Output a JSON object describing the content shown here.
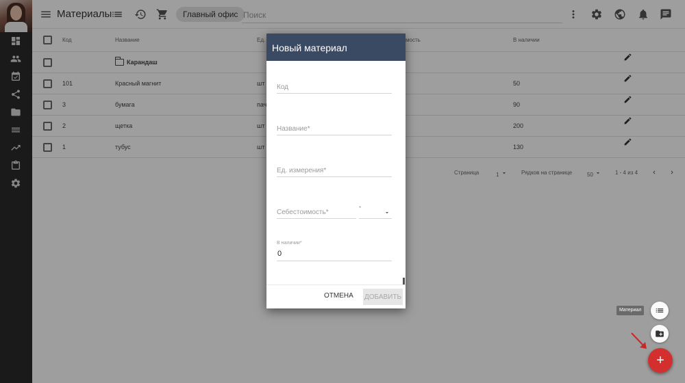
{
  "topbar": {
    "title": "Материалы",
    "office": "Главный офис",
    "search_placeholder": "Поиск"
  },
  "table": {
    "headers": {
      "code": "Код",
      "name": "Название",
      "unit": "Ед.",
      "cost": "мость",
      "stock": "В наличии"
    },
    "rows": [
      {
        "code": "",
        "name": "Карандаш",
        "unit": "",
        "stock": "",
        "is_folder": true
      },
      {
        "code": "101",
        "name": "Красный магнит",
        "unit": "шт",
        "stock": "50"
      },
      {
        "code": "3",
        "name": "бумага",
        "unit": "пач",
        "stock": "90"
      },
      {
        "code": "2",
        "name": "щетка",
        "unit": "шт",
        "stock": "200"
      },
      {
        "code": "1",
        "name": "тубус",
        "unit": "шт",
        "stock": "130"
      }
    ]
  },
  "pager": {
    "page_label": "Страница",
    "page_value": "1",
    "rows_label": "Рядков на странице",
    "rows_value": "50",
    "range": "1 - 4 из 4"
  },
  "dialog": {
    "title": "Новый материал",
    "fields": {
      "code": "Код",
      "name": "Название",
      "unit": "Ед. измерения",
      "cost": "Себестоимость",
      "stock": "В наличии",
      "stock_value": "0"
    },
    "cancel": "ОТМЕНА",
    "add": "ДОБАВИТЬ"
  },
  "fab": {
    "tooltip": "Материал",
    "main": "+"
  },
  "colors": {
    "dialog_header": "#3b4a63",
    "fab": "#d32f2f",
    "rail": "#2b2b2b"
  }
}
